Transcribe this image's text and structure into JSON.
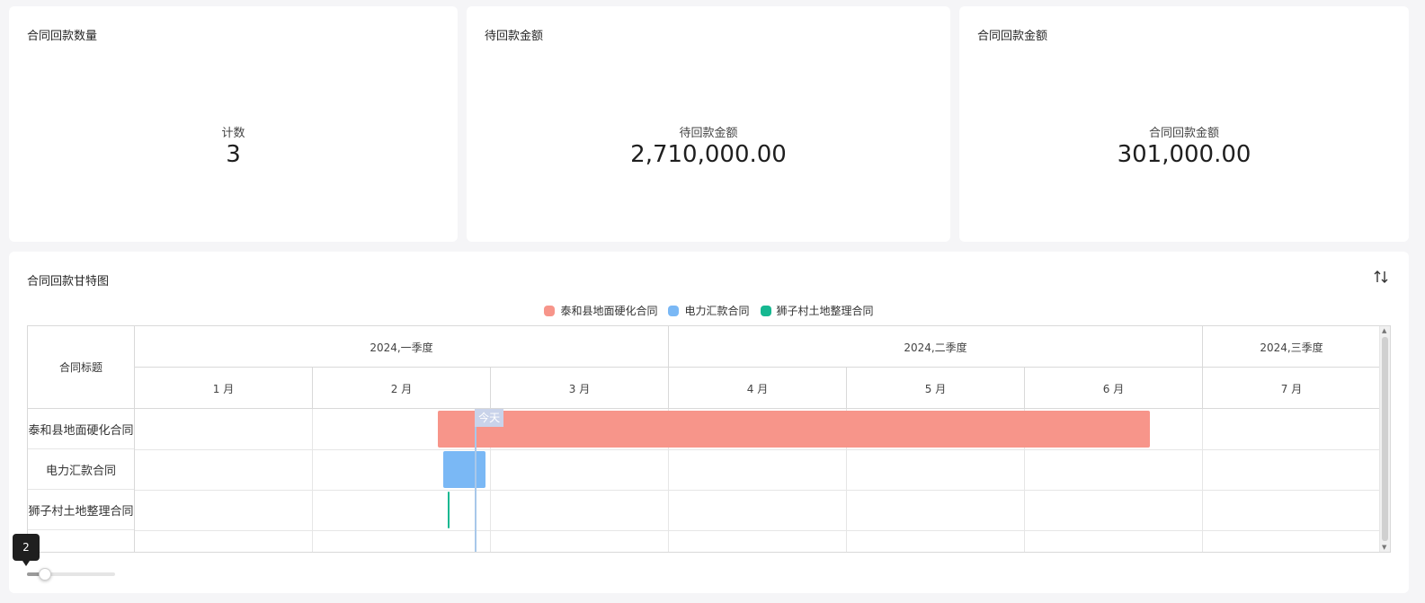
{
  "kpis": [
    {
      "title": "合同回款数量",
      "label": "计数",
      "value": "3"
    },
    {
      "title": "待回款金额",
      "label": "待回款金额",
      "value": "2,710,000.00"
    },
    {
      "title": "合同回款金额",
      "label": "合同回款金额",
      "value": "301,000.00"
    }
  ],
  "gantt": {
    "title": "合同回款甘特图",
    "sort_icon": "sort-arrows-icon",
    "legend": [
      {
        "label": "泰和县地面硬化合同",
        "color": "#f7958a"
      },
      {
        "label": "电力汇款合同",
        "color": "#7ab8f5"
      },
      {
        "label": "狮子村土地整理合同",
        "color": "#16b891"
      }
    ],
    "left_header": "合同标题",
    "quarters": [
      "2024,一季度",
      "2024,二季度",
      "2024,三季度"
    ],
    "months": [
      "1 月",
      "2 月",
      "3 月",
      "4 月",
      "5 月",
      "6 月",
      "7 月"
    ],
    "rows": [
      {
        "label": "泰和县地面硬化合同",
        "color": "#f7958a",
        "start_month": 1.7,
        "end_month": 5.7
      },
      {
        "label": "电力汇款合同",
        "color": "#7ab8f5",
        "start_month": 1.73,
        "end_month": 1.97
      },
      {
        "label": "狮子村土地整理合同",
        "color": "#16b891",
        "start_month": 1.76,
        "end_month": 1.77
      }
    ],
    "today_label": "今天",
    "today_month": 1.91
  },
  "slider": {
    "value": "2",
    "fraction": 0.2
  }
}
